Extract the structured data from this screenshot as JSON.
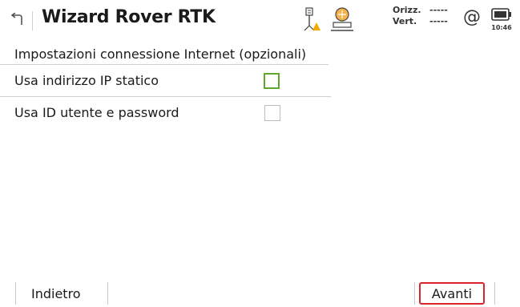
{
  "header": {
    "title": "Wizard Rover RTK",
    "precision": {
      "horizontal_label": "Orizz.",
      "horizontal_value": "-----",
      "vertical_label": "Vert.",
      "vertical_value": "-----"
    },
    "at_symbol": "@",
    "time": "10:46",
    "icons": {
      "back": "back-arrow-icon",
      "rover": "rover-receiver-icon",
      "base": "base-station-icon",
      "battery": "battery-icon"
    }
  },
  "section": {
    "title": "Impostazioni connessione Internet (opzionali)"
  },
  "options": [
    {
      "label": "Usa indirizzo IP statico",
      "checked": false,
      "focused": true
    },
    {
      "label": "Usa ID utente e password",
      "checked": false,
      "focused": false
    }
  ],
  "footer": {
    "back_label": "Indietro",
    "next_label": "Avanti"
  },
  "colors": {
    "focus_border": "#5ea62d",
    "next_highlight": "#d9262c",
    "warning": "#f2a900"
  }
}
